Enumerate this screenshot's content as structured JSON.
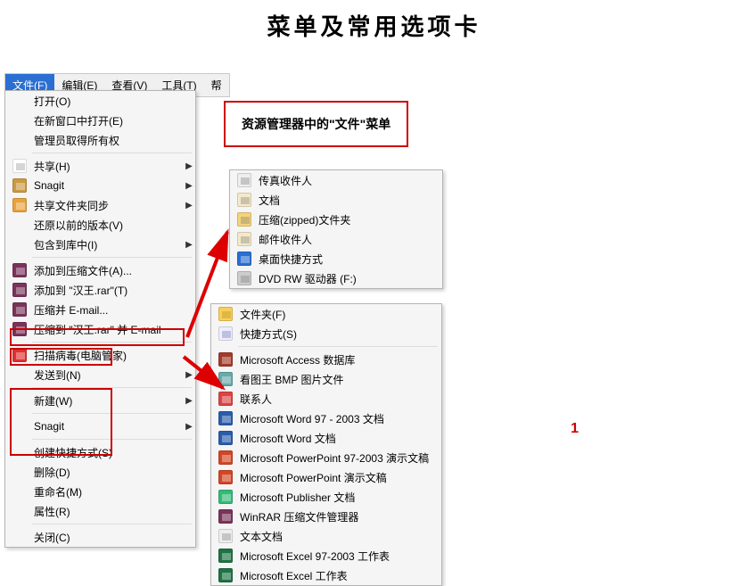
{
  "title": "菜单及常用选项卡",
  "page_number": "1",
  "callout": "资源管理器中的\"文件\"菜单",
  "menubar": {
    "active": "文件(F)",
    "tabs": [
      "文件(F)",
      "编辑(E)",
      "查看(V)",
      "工具(T)",
      "帮"
    ]
  },
  "menu1": [
    {
      "label": "打开(O)",
      "icon": null,
      "arrow": false
    },
    {
      "label": "在新窗口中打开(E)",
      "icon": null,
      "arrow": false
    },
    {
      "label": "管理员取得所有权",
      "icon": null,
      "arrow": false
    },
    {
      "sep": true
    },
    {
      "label": "共享(H)",
      "icon": "share",
      "arrow": true
    },
    {
      "label": "Snagit",
      "icon": "snagit",
      "arrow": true
    },
    {
      "label": "共享文件夹同步",
      "icon": "sync",
      "arrow": true
    },
    {
      "label": "还原以前的版本(V)",
      "icon": null,
      "arrow": false
    },
    {
      "label": "包含到库中(I)",
      "icon": null,
      "arrow": true
    },
    {
      "sep": true
    },
    {
      "label": "添加到压缩文件(A)...",
      "icon": "rar",
      "arrow": false
    },
    {
      "label": "添加到 \"汉王.rar\"(T)",
      "icon": "rar",
      "arrow": false
    },
    {
      "label": "压缩并 E-mail...",
      "icon": "rar",
      "arrow": false
    },
    {
      "label": "压缩到 \"汉王.rar\" 并 E-mail",
      "icon": "rar",
      "arrow": false
    },
    {
      "sep": true
    },
    {
      "label": "扫描病毒(电脑管家)",
      "icon": "shield",
      "arrow": false
    },
    {
      "label": "发送到(N)",
      "icon": null,
      "arrow": true
    },
    {
      "sep": true
    },
    {
      "label": "新建(W)",
      "icon": null,
      "arrow": true
    },
    {
      "sep": true
    },
    {
      "label": "Snagit",
      "icon": null,
      "arrow": true
    },
    {
      "sep": true
    },
    {
      "label": "创建快捷方式(S)",
      "icon": null,
      "arrow": false
    },
    {
      "label": "删除(D)",
      "icon": null,
      "arrow": false
    },
    {
      "label": "重命名(M)",
      "icon": null,
      "arrow": false
    },
    {
      "label": "属性(R)",
      "icon": null,
      "arrow": false
    },
    {
      "sep": true
    },
    {
      "label": "关闭(C)",
      "icon": null,
      "arrow": false
    }
  ],
  "menu2": [
    {
      "label": "传真收件人",
      "icon": "fax"
    },
    {
      "label": "文档",
      "icon": "doc"
    },
    {
      "label": "压缩(zipped)文件夹",
      "icon": "zip"
    },
    {
      "label": "邮件收件人",
      "icon": "mail"
    },
    {
      "label": "桌面快捷方式",
      "icon": "desktop"
    },
    {
      "label": "DVD RW 驱动器 (F:)",
      "icon": "dvd"
    }
  ],
  "menu3": [
    {
      "label": "文件夹(F)",
      "icon": "folder"
    },
    {
      "label": "快捷方式(S)",
      "icon": "shortcut"
    },
    {
      "sep": true
    },
    {
      "label": "Microsoft Access 数据库",
      "icon": "access"
    },
    {
      "label": "看图王 BMP 图片文件",
      "icon": "bmp"
    },
    {
      "label": "联系人",
      "icon": "contact"
    },
    {
      "label": "Microsoft Word 97 - 2003 文档",
      "icon": "word"
    },
    {
      "label": "Microsoft Word 文档",
      "icon": "word"
    },
    {
      "label": "Microsoft PowerPoint 97-2003 演示文稿",
      "icon": "ppt"
    },
    {
      "label": "Microsoft PowerPoint 演示文稿",
      "icon": "ppt"
    },
    {
      "label": "Microsoft Publisher 文档",
      "icon": "pub"
    },
    {
      "label": "WinRAR 压缩文件管理器",
      "icon": "rar"
    },
    {
      "label": "文本文档",
      "icon": "txt"
    },
    {
      "label": "Microsoft Excel 97-2003 工作表",
      "icon": "excel"
    },
    {
      "label": "Microsoft Excel 工作表",
      "icon": "excel"
    }
  ],
  "icons": {
    "share": {
      "bg": "#fff",
      "fg": "#888"
    },
    "snagit": {
      "bg": "#c94",
      "fg": "#fff"
    },
    "sync": {
      "bg": "#e8a33d",
      "fg": "#fff"
    },
    "rar": {
      "bg": "#7a335a",
      "fg": "#fff"
    },
    "shield": {
      "bg": "#e03030",
      "fg": "#fff"
    },
    "fax": {
      "bg": "#eee",
      "fg": "#777"
    },
    "doc": {
      "bg": "#f4e9c8",
      "fg": "#777"
    },
    "zip": {
      "bg": "#f4d37a",
      "fg": "#777"
    },
    "mail": {
      "bg": "#f4e9c8",
      "fg": "#777"
    },
    "desktop": {
      "bg": "#2a6fd3",
      "fg": "#fff"
    },
    "dvd": {
      "bg": "#ccc",
      "fg": "#777"
    },
    "folder": {
      "bg": "#f8cf5a",
      "fg": "#b88a1e"
    },
    "shortcut": {
      "bg": "#eef",
      "fg": "#66a"
    },
    "access": {
      "bg": "#a33a2a",
      "fg": "#fff"
    },
    "bmp": {
      "bg": "#6aa",
      "fg": "#fff"
    },
    "contact": {
      "bg": "#d44",
      "fg": "#fff"
    },
    "word": {
      "bg": "#2a5dab",
      "fg": "#fff"
    },
    "ppt": {
      "bg": "#d24726",
      "fg": "#fff"
    },
    "pub": {
      "bg": "#3b7",
      "fg": "#fff"
    },
    "txt": {
      "bg": "#eee",
      "fg": "#777"
    },
    "excel": {
      "bg": "#1f7244",
      "fg": "#fff"
    }
  }
}
